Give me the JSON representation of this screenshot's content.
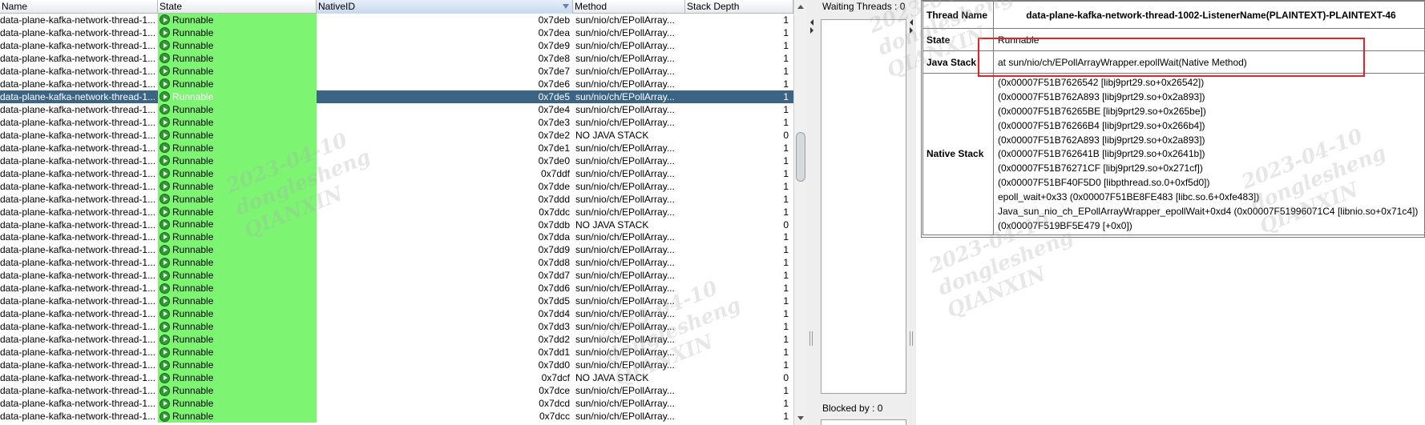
{
  "table": {
    "columns": [
      "Name",
      "State",
      "NativeID",
      "Method",
      "Stack Depth"
    ],
    "rows": [
      {
        "name": "data-plane-kafka-network-thread-1...",
        "state": "Runnable",
        "native_id": "0x7deb",
        "method": "sun/nio/ch/EPollArray...",
        "depth": "1"
      },
      {
        "name": "data-plane-kafka-network-thread-1...",
        "state": "Runnable",
        "native_id": "0x7dea",
        "method": "sun/nio/ch/EPollArray...",
        "depth": "1"
      },
      {
        "name": "data-plane-kafka-network-thread-1...",
        "state": "Runnable",
        "native_id": "0x7de9",
        "method": "sun/nio/ch/EPollArray...",
        "depth": "1"
      },
      {
        "name": "data-plane-kafka-network-thread-1...",
        "state": "Runnable",
        "native_id": "0x7de8",
        "method": "sun/nio/ch/EPollArray...",
        "depth": "1"
      },
      {
        "name": "data-plane-kafka-network-thread-1...",
        "state": "Runnable",
        "native_id": "0x7de7",
        "method": "sun/nio/ch/EPollArray...",
        "depth": "1"
      },
      {
        "name": "data-plane-kafka-network-thread-1...",
        "state": "Runnable",
        "native_id": "0x7de6",
        "method": "sun/nio/ch/EPollArray...",
        "depth": "1"
      },
      {
        "name": "data-plane-kafka-network-thread-1...",
        "state": "Runnable",
        "native_id": "0x7de5",
        "method": "sun/nio/ch/EPollArray...",
        "depth": "1",
        "selected": true
      },
      {
        "name": "data-plane-kafka-network-thread-1...",
        "state": "Runnable",
        "native_id": "0x7de4",
        "method": "sun/nio/ch/EPollArray...",
        "depth": "1"
      },
      {
        "name": "data-plane-kafka-network-thread-1...",
        "state": "Runnable",
        "native_id": "0x7de3",
        "method": "sun/nio/ch/EPollArray...",
        "depth": "1"
      },
      {
        "name": "data-plane-kafka-network-thread-1...",
        "state": "Runnable",
        "native_id": "0x7de2",
        "method": "NO JAVA STACK",
        "depth": "0"
      },
      {
        "name": "data-plane-kafka-network-thread-1...",
        "state": "Runnable",
        "native_id": "0x7de1",
        "method": "sun/nio/ch/EPollArray...",
        "depth": "1"
      },
      {
        "name": "data-plane-kafka-network-thread-1...",
        "state": "Runnable",
        "native_id": "0x7de0",
        "method": "sun/nio/ch/EPollArray...",
        "depth": "1"
      },
      {
        "name": "data-plane-kafka-network-thread-1...",
        "state": "Runnable",
        "native_id": "0x7ddf",
        "method": "sun/nio/ch/EPollArray...",
        "depth": "1"
      },
      {
        "name": "data-plane-kafka-network-thread-1...",
        "state": "Runnable",
        "native_id": "0x7dde",
        "method": "sun/nio/ch/EPollArray...",
        "depth": "1"
      },
      {
        "name": "data-plane-kafka-network-thread-1...",
        "state": "Runnable",
        "native_id": "0x7ddd",
        "method": "sun/nio/ch/EPollArray...",
        "depth": "1"
      },
      {
        "name": "data-plane-kafka-network-thread-1...",
        "state": "Runnable",
        "native_id": "0x7ddc",
        "method": "sun/nio/ch/EPollArray...",
        "depth": "1"
      },
      {
        "name": "data-plane-kafka-network-thread-1...",
        "state": "Runnable",
        "native_id": "0x7ddb",
        "method": "NO JAVA STACK",
        "depth": "0"
      },
      {
        "name": "data-plane-kafka-network-thread-1...",
        "state": "Runnable",
        "native_id": "0x7dda",
        "method": "sun/nio/ch/EPollArray...",
        "depth": "1"
      },
      {
        "name": "data-plane-kafka-network-thread-1...",
        "state": "Runnable",
        "native_id": "0x7dd9",
        "method": "sun/nio/ch/EPollArray...",
        "depth": "1"
      },
      {
        "name": "data-plane-kafka-network-thread-1...",
        "state": "Runnable",
        "native_id": "0x7dd8",
        "method": "sun/nio/ch/EPollArray...",
        "depth": "1"
      },
      {
        "name": "data-plane-kafka-network-thread-1...",
        "state": "Runnable",
        "native_id": "0x7dd7",
        "method": "sun/nio/ch/EPollArray...",
        "depth": "1"
      },
      {
        "name": "data-plane-kafka-network-thread-1...",
        "state": "Runnable",
        "native_id": "0x7dd6",
        "method": "sun/nio/ch/EPollArray...",
        "depth": "1"
      },
      {
        "name": "data-plane-kafka-network-thread-1...",
        "state": "Runnable",
        "native_id": "0x7dd5",
        "method": "sun/nio/ch/EPollArray...",
        "depth": "1"
      },
      {
        "name": "data-plane-kafka-network-thread-1...",
        "state": "Runnable",
        "native_id": "0x7dd4",
        "method": "sun/nio/ch/EPollArray...",
        "depth": "1"
      },
      {
        "name": "data-plane-kafka-network-thread-1...",
        "state": "Runnable",
        "native_id": "0x7dd3",
        "method": "sun/nio/ch/EPollArray...",
        "depth": "1"
      },
      {
        "name": "data-plane-kafka-network-thread-1...",
        "state": "Runnable",
        "native_id": "0x7dd2",
        "method": "sun/nio/ch/EPollArray...",
        "depth": "1"
      },
      {
        "name": "data-plane-kafka-network-thread-1...",
        "state": "Runnable",
        "native_id": "0x7dd1",
        "method": "sun/nio/ch/EPollArray...",
        "depth": "1"
      },
      {
        "name": "data-plane-kafka-network-thread-1...",
        "state": "Runnable",
        "native_id": "0x7dd0",
        "method": "sun/nio/ch/EPollArray...",
        "depth": "1"
      },
      {
        "name": "data-plane-kafka-network-thread-1...",
        "state": "Runnable",
        "native_id": "0x7dcf",
        "method": "NO JAVA STACK",
        "depth": "0"
      },
      {
        "name": "data-plane-kafka-network-thread-1...",
        "state": "Runnable",
        "native_id": "0x7dce",
        "method": "sun/nio/ch/EPollArray...",
        "depth": "1"
      },
      {
        "name": "data-plane-kafka-network-thread-1...",
        "state": "Runnable",
        "native_id": "0x7dcd",
        "method": "sun/nio/ch/EPollArray...",
        "depth": "1"
      },
      {
        "name": "data-plane-kafka-network-thread-1...",
        "state": "Runnable",
        "native_id": "0x7dcc",
        "method": "sun/nio/ch/EPollArray...",
        "depth": "1"
      }
    ]
  },
  "waiting_panel": {
    "waiting_label": "Waiting Threads : 0",
    "blocked_label": "Blocked by : 0"
  },
  "details": {
    "thread_name_label": "Thread Name",
    "thread_name": "data-plane-kafka-network-thread-1002-ListenerName(PLAINTEXT)-PLAINTEXT-46",
    "state_label": "State",
    "state": "Runnable",
    "java_stack_label": "Java Stack",
    "java_stack": "at sun/nio/ch/EPollArrayWrapper.epollWait(Native Method)",
    "native_stack_label": "Native Stack",
    "native_stack": [
      "(0x00007F51B7626542 [libj9prt29.so+0x26542])",
      "(0x00007F51B762A893 [libj9prt29.so+0x2a893])",
      "(0x00007F51B76265BE [libj9prt29.so+0x265be])",
      "(0x00007F51B76266B4 [libj9prt29.so+0x266b4])",
      "(0x00007F51B762A893 [libj9prt29.so+0x2a893])",
      "(0x00007F51B762641B [libj9prt29.so+0x2641b])",
      "(0x00007F51B76271CF [libj9prt29.so+0x271cf])",
      "(0x00007F51BF40F5D0 [libpthread.so.0+0xf5d0])",
      "epoll_wait+0x33 (0x00007F51BE8FE483 [libc.so.6+0xfe483])",
      "Java_sun_nio_ch_EPollArrayWrapper_epollWait+0xd4 (0x00007F51996071C4 [libnio.so+0x71c4])",
      "(0x00007F519BF5E479 [+0x0])"
    ]
  },
  "watermark": {
    "date": "2023-04-10",
    "user": "donglesheng",
    "org": "QIANXIN"
  },
  "colors": {
    "state_runnable_bg": "#7df573",
    "selected_row_bg": "#3a6384",
    "highlight_box": "#e6212a"
  }
}
